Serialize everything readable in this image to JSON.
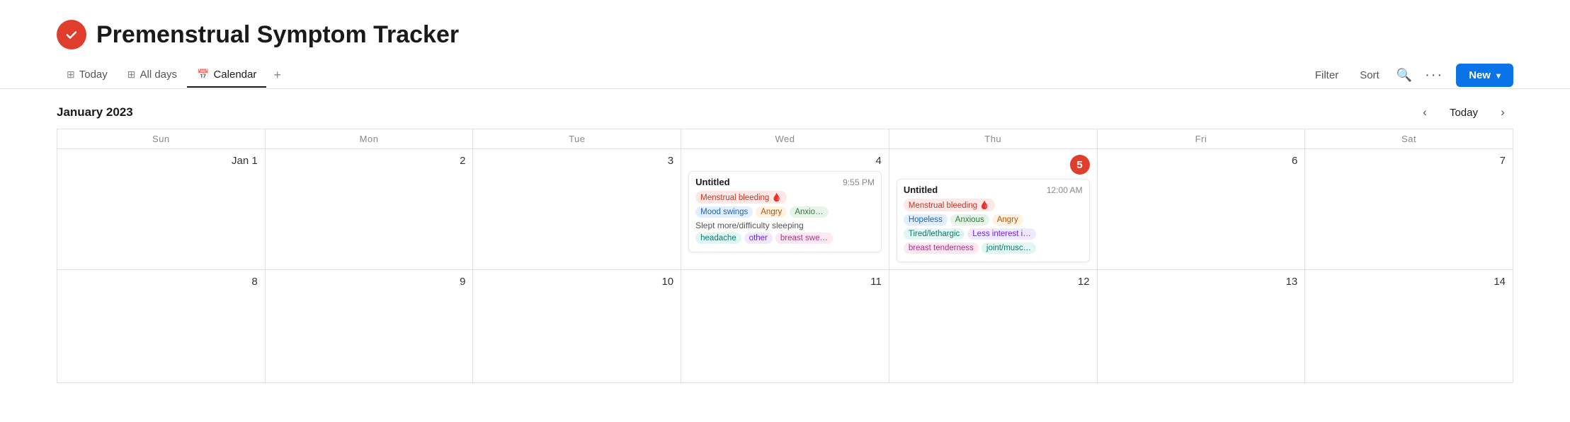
{
  "app": {
    "title": "Premenstrual Symptom Tracker",
    "icon_label": "checkmark-icon"
  },
  "tabs": [
    {
      "id": "today",
      "label": "Today",
      "icon": "grid",
      "active": false
    },
    {
      "id": "alldays",
      "label": "All days",
      "icon": "grid",
      "active": false
    },
    {
      "id": "calendar",
      "label": "Calendar",
      "icon": "calendar",
      "active": true
    }
  ],
  "toolbar": {
    "filter_label": "Filter",
    "sort_label": "Sort",
    "more_label": "···",
    "new_label": "New"
  },
  "calendar": {
    "month_title": "January 2023",
    "today_label": "Today",
    "days_of_week": [
      "Sun",
      "Mon",
      "Tue",
      "Wed",
      "Thu",
      "Fri",
      "Sat"
    ],
    "week1": [
      {
        "date": "Jan 1",
        "events": []
      },
      {
        "date": "2",
        "events": []
      },
      {
        "date": "3",
        "events": []
      },
      {
        "date": "4",
        "events": [
          {
            "title": "Untitled",
            "time": "9:55 PM",
            "tags1": [
              {
                "label": "Menstrual bleeding 🩸",
                "style": "red"
              }
            ],
            "tags2": [
              {
                "label": "Mood swings",
                "style": "blue"
              },
              {
                "label": "Angry",
                "style": "orange"
              },
              {
                "label": "Anxio…",
                "style": "green"
              }
            ],
            "text": "Slept more/difficulty sleeping",
            "tags3": [
              {
                "label": "headache",
                "style": "teal"
              },
              {
                "label": "other",
                "style": "purple"
              },
              {
                "label": "breast swe…",
                "style": "pink"
              }
            ]
          }
        ]
      },
      {
        "date": "5",
        "today": true,
        "events": [
          {
            "title": "Untitled",
            "time": "12:00 AM",
            "tags1": [
              {
                "label": "Menstrual bleeding 🩸",
                "style": "red"
              }
            ],
            "tags2": [
              {
                "label": "Hopeless",
                "style": "blue"
              },
              {
                "label": "Anxious",
                "style": "green"
              },
              {
                "label": "Angry",
                "style": "orange"
              }
            ],
            "text2a": "Tired/lethargic",
            "text2b": "Less interest i…",
            "tags3": [
              {
                "label": "breast tenderness",
                "style": "pink"
              },
              {
                "label": "joint/musc…",
                "style": "teal"
              }
            ]
          }
        ]
      },
      {
        "date": "6",
        "events": []
      },
      {
        "date": "7",
        "events": []
      }
    ],
    "week2": [
      {
        "date": "8",
        "events": []
      },
      {
        "date": "9",
        "events": []
      },
      {
        "date": "10",
        "events": []
      },
      {
        "date": "11",
        "events": []
      },
      {
        "date": "12",
        "events": []
      },
      {
        "date": "13",
        "events": []
      },
      {
        "date": "14",
        "events": []
      }
    ]
  }
}
